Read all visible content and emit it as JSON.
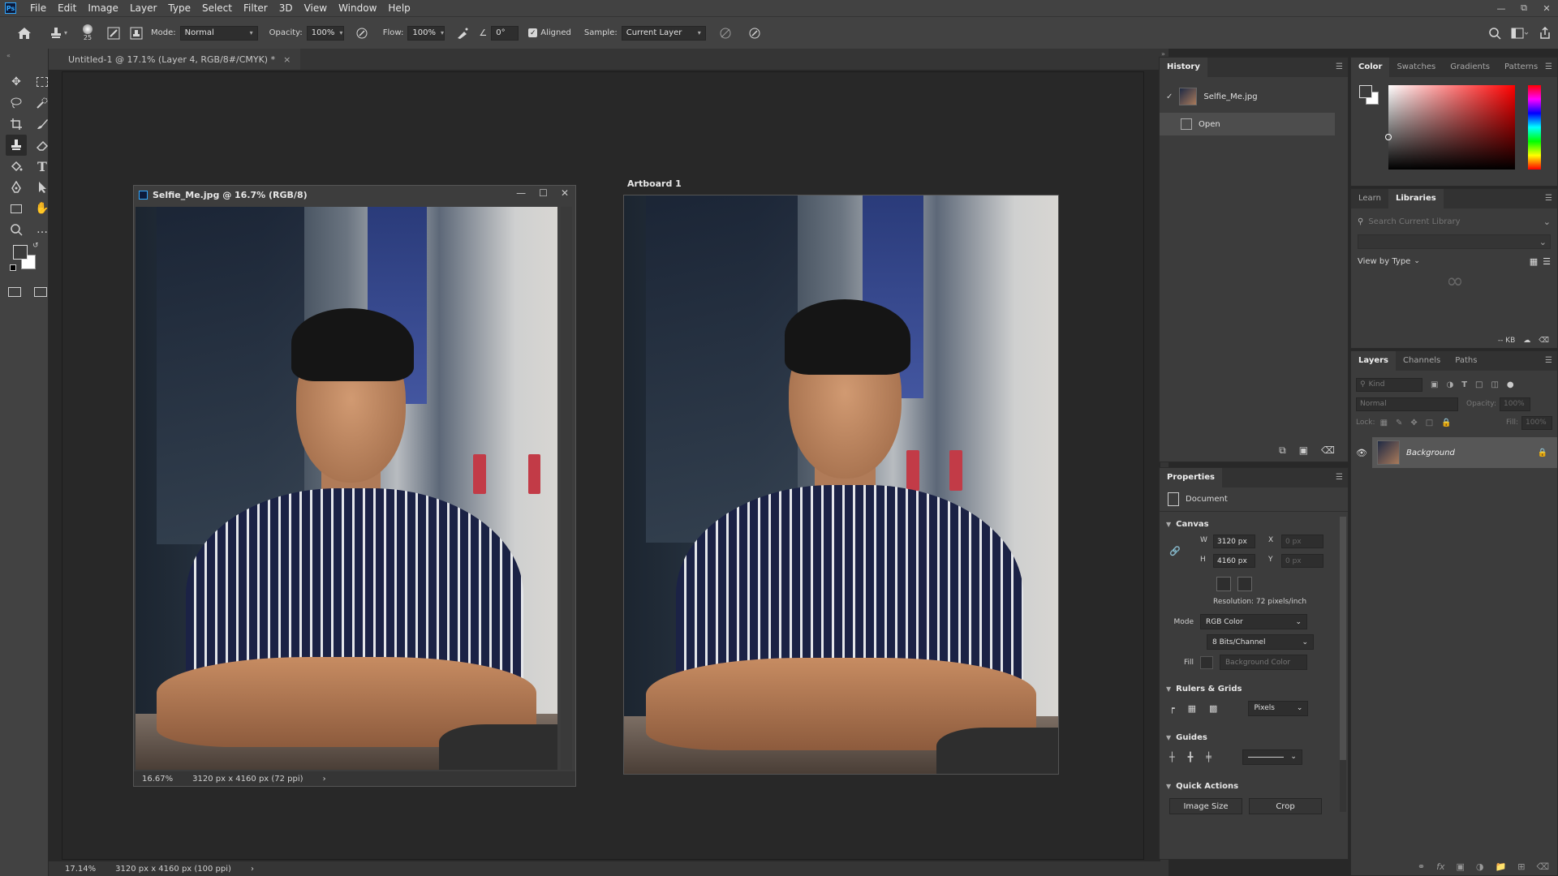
{
  "menubar": {
    "logo": "Ps",
    "items": [
      "File",
      "Edit",
      "Image",
      "Layer",
      "Type",
      "Select",
      "Filter",
      "3D",
      "View",
      "Window",
      "Help"
    ]
  },
  "options": {
    "brush_size": "25",
    "mode_label": "Mode:",
    "mode_value": "Normal",
    "opacity_label": "Opacity:",
    "opacity_value": "100%",
    "flow_label": "Flow:",
    "flow_value": "100%",
    "angle_value": "0°",
    "aligned_label": "Aligned",
    "sample_label": "Sample:",
    "sample_value": "Current Layer"
  },
  "document": {
    "tab_title": "Untitled-1 @ 17.1% (Layer 4, RGB/8#/CMYK) *",
    "tab_close": "×",
    "artboard_label": "Artboard 1",
    "status_zoom": "17.14%",
    "status_info": "3120 px x 4160 px (100 ppi)",
    "status_arrow": "›"
  },
  "float_window": {
    "title": "Selfie_Me.jpg @ 16.7% (RGB/8)",
    "status_zoom": "16.67%",
    "status_info": "3120 px x 4160 px (72 ppi)",
    "status_arrow": "›"
  },
  "history": {
    "tab": "History",
    "snapshot": "Selfie_Me.jpg",
    "steps": [
      "Open"
    ]
  },
  "properties": {
    "tab": "Properties",
    "doc_label": "Document",
    "canvas_head": "Canvas",
    "w_label": "W",
    "w_value": "3120 px",
    "h_label": "H",
    "h_value": "4160 px",
    "x_label": "X",
    "x_value": "0 px",
    "y_label": "Y",
    "y_value": "0 px",
    "resolution": "Resolution: 72 pixels/inch",
    "mode_label": "Mode",
    "mode_value": "RGB Color",
    "bits_value": "8 Bits/Channel",
    "fill_label": "Fill",
    "fill_value": "Background Color",
    "rulers_head": "Rulers & Grids",
    "units_value": "Pixels",
    "guides_head": "Guides",
    "quick_head": "Quick Actions",
    "image_size_btn": "Image Size",
    "crop_btn": "Crop"
  },
  "color_panel": {
    "tabs": [
      "Color",
      "Swatches",
      "Gradients",
      "Patterns"
    ]
  },
  "libraries": {
    "tabs": [
      "Learn",
      "Libraries"
    ],
    "search_placeholder": "Search Current Library",
    "view_by": "View by Type",
    "kb": "-- KB"
  },
  "layers": {
    "tabs": [
      "Layers",
      "Channels",
      "Paths"
    ],
    "kind_placeholder": "Kind",
    "blend_value": "Normal",
    "opacity_label": "Opacity:",
    "opacity_value": "100%",
    "lock_label": "Lock:",
    "fill_label": "Fill:",
    "fill_value": "100%",
    "layer_name": "Background"
  },
  "icons": {
    "home": "home-icon",
    "stamp": "clone-stamp-icon",
    "search": "search-icon",
    "share": "share-icon"
  },
  "colors": {
    "accent": "#31a8ff",
    "panel_bg": "#3c3c3c",
    "app_bg": "#282828"
  }
}
